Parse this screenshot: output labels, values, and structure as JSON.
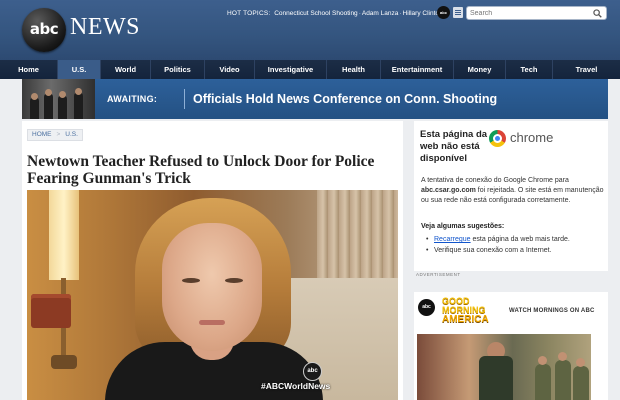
{
  "header": {
    "logo_text": "abc",
    "news_text": "NEWS",
    "hot_topics_label": "HOT TOPICS:",
    "hot_topics": [
      "Connecticut School Shooting",
      "Adam Lanza",
      "Hillary Clinton"
    ],
    "hot_topics_separator": "·",
    "mini_logo_text": "abc",
    "search_placeholder": "Search"
  },
  "nav": {
    "items": [
      "Home",
      "U.S.",
      "World",
      "Politics",
      "Video",
      "Investigative",
      "Health",
      "Entertainment",
      "Money",
      "Tech",
      "Travel"
    ],
    "active": "U.S."
  },
  "banner": {
    "label": "AWAITING:",
    "headline": "Officials Hold News Conference on Conn. Shooting"
  },
  "article": {
    "breadcrumb": [
      "HOME",
      "U.S."
    ],
    "breadcrumb_separator": ">",
    "headline": "Newtown Teacher Refused to Unlock Door for Police Fearing Gunman's Trick",
    "video_watermark_logo": "abc",
    "video_watermark_tag": "#ABCWorldNews"
  },
  "ad_error": {
    "title": "Esta página da web não está disponível",
    "brand": "chrome",
    "body_prefix": "A tentativa de conexão do Google Chrome para ",
    "body_host": "abc.csar.go.com",
    "body_suffix": " foi rejeitada. O site está em manutenção ou sua rede não está configurada corretamente.",
    "suggestions_title": "Veja algumas sugestões:",
    "suggestion_1_link": "Recarregue",
    "suggestion_1_text": " esta página da web mais tarde.",
    "suggestion_2": "Verifique sua conexão com a Internet.",
    "label": "ADVERTISEMENT"
  },
  "gma": {
    "logo_text": "abc",
    "title_line1": "GOOD",
    "title_line2": "MORNING",
    "title_line3": "AMERICA",
    "watch_text": "WATCH MORNINGS ON ABC"
  }
}
